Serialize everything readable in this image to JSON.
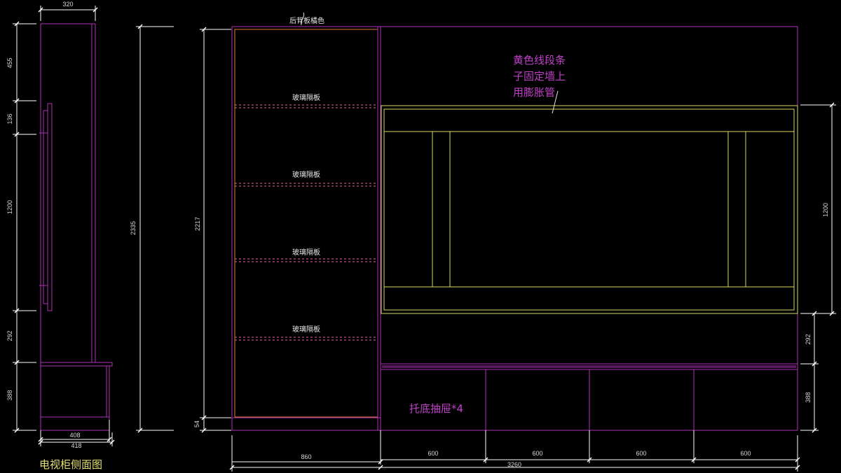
{
  "side_view": {
    "caption": "电视柜侧面图",
    "dims": {
      "top_width": "320",
      "v_455": "455",
      "v_136": "136",
      "v_1200": "1200",
      "v_292": "292",
      "v_388": "388",
      "w_408": "408",
      "w_418": "418"
    }
  },
  "front_view": {
    "dims": {
      "total_height": "2335",
      "cabinet_height": "2217",
      "base_54": "54",
      "left_width": "860",
      "d1": "600",
      "d2": "600",
      "d3": "600",
      "d4": "600",
      "total_width": "3260",
      "right_1200": "1200",
      "right_292": "292",
      "right_388": "388"
    },
    "notes": {
      "back_panel": "后背板橘色",
      "glass1": "玻璃隔板",
      "glass2": "玻璃隔板",
      "glass3": "玻璃隔板",
      "glass4": "玻璃隔板",
      "yellow_line1": "黄色线段条",
      "yellow_line2": "子固定墙上",
      "yellow_line3": "用膨胀管",
      "drawers": "托底抽屉*4"
    }
  },
  "colors": {
    "background": "#000000",
    "cabinet_magenta": "#b030b8",
    "orange": "#e07838",
    "yellow": "#d8d860",
    "dim_white": "#d8d8d8",
    "dashed_pink": "#e060a0"
  }
}
